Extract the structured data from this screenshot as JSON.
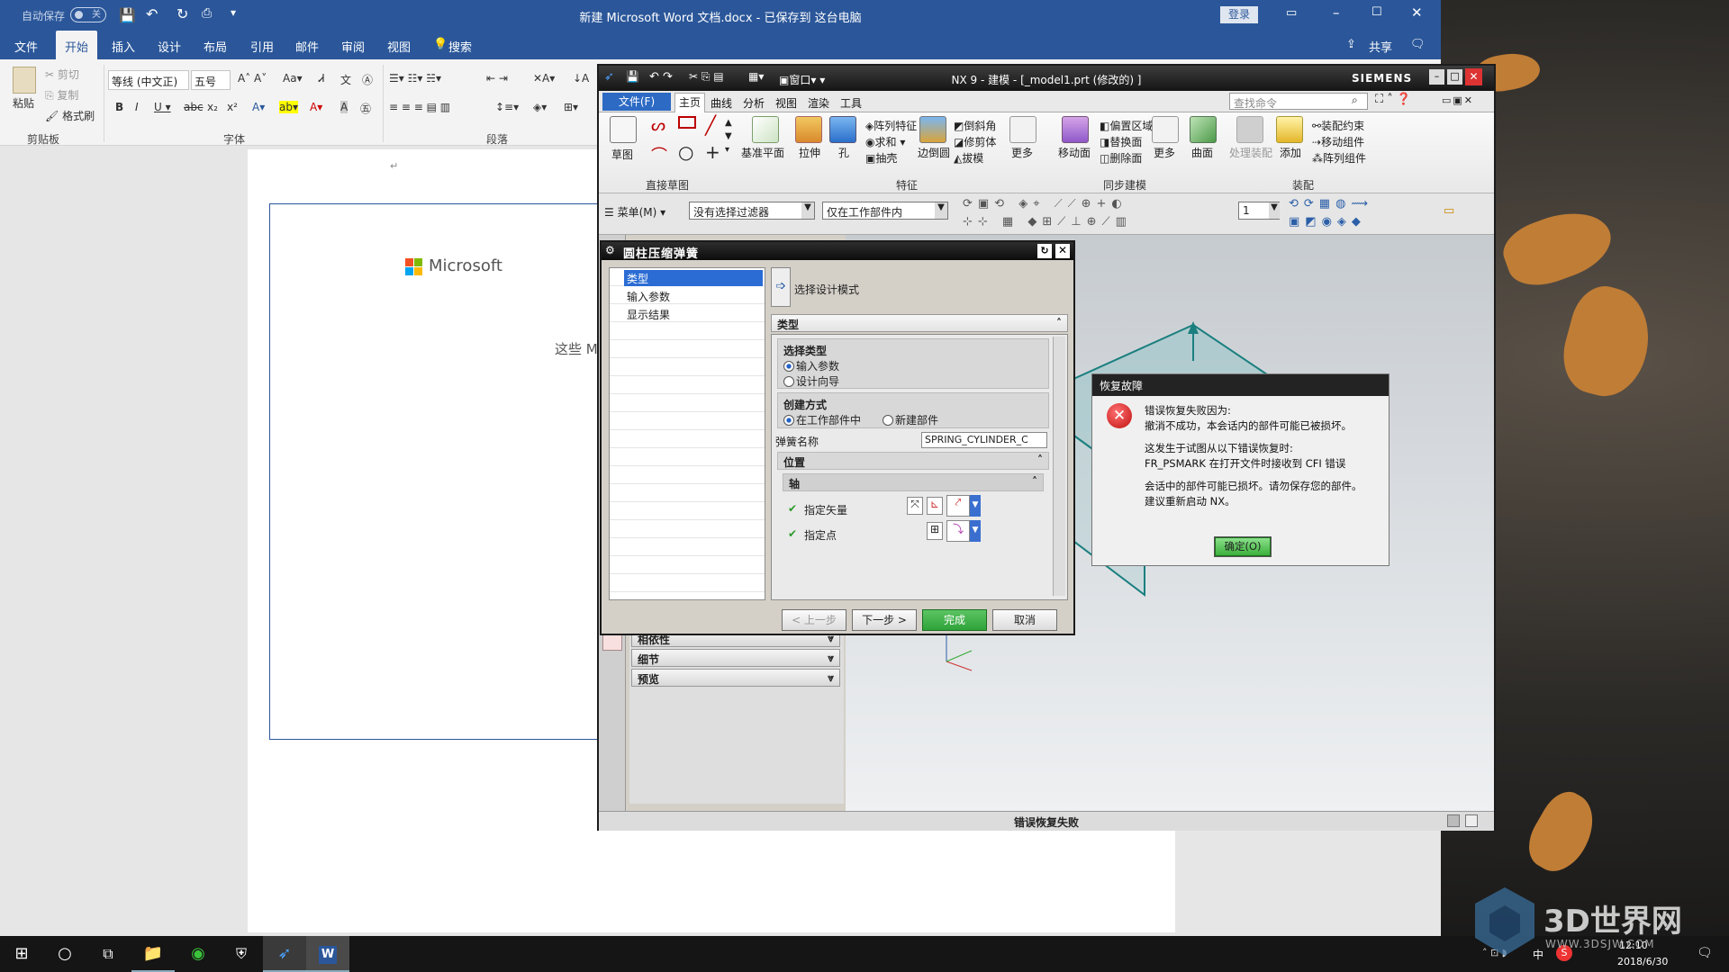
{
  "word": {
    "autosave_label": "自动保存",
    "autosave_state": "关",
    "title": "新建 Microsoft Word 文档.docx - 已保存到 这台电脑",
    "login_button": "登录",
    "share_label": "共享",
    "tabs": [
      "文件",
      "开始",
      "插入",
      "设计",
      "布局",
      "引用",
      "邮件",
      "审阅",
      "视图"
    ],
    "search_label": "搜索",
    "clipboard": {
      "paste": "粘贴",
      "cut": "剪切",
      "copy": "复制",
      "format_painter": "格式刷",
      "group": "剪贴板"
    },
    "font": {
      "name": "等线 (中文正)",
      "size": "五号",
      "group": "字体"
    },
    "paragraph_group": "段落",
    "doc_brand": "Microsoft",
    "doc_text": "这些 M",
    "para_mark": "↵"
  },
  "nx": {
    "title": "NX 9 - 建模 - [_model1.prt  (修改的)  ]",
    "brand": "SIEMENS",
    "window_menu": "窗口",
    "search_placeholder": "查找命令",
    "tabs": [
      "文件(F)",
      "主页",
      "曲线",
      "分析",
      "视图",
      "渲染",
      "工具"
    ],
    "ribbon": {
      "sketch": "草图",
      "direct_sketch": "直接草图",
      "datum_plane": "基准平面",
      "extrude": "拉伸",
      "hole": "孔",
      "pattern_feature": "阵列特征",
      "unite": "求和",
      "shell": "抽壳",
      "edge_blend": "边倒圆",
      "chamfer": "倒斜角",
      "trim_body": "修剪体",
      "draft": "拔模",
      "more": "更多",
      "feature_group": "特征",
      "move_face": "移动面",
      "offset_region": "偏置区域",
      "replace_face": "替换面",
      "delete_face": "删除面",
      "more2": "更多",
      "sync_group": "同步建模",
      "surface": "曲面",
      "process_assembly": "处理装配",
      "add": "添加",
      "assembly_constraint": "装配约束",
      "move_component": "移动组件",
      "pattern_component": "阵列组件",
      "assembly_group": "装配"
    },
    "toolbar": {
      "menu": "菜单(M)",
      "filter": "没有选择过滤器",
      "scope": "仅在工作部件内",
      "layer": "1"
    },
    "navigator_sections": [
      "相依性",
      "细节",
      "预览"
    ],
    "status": "错误恢复失败"
  },
  "spring_dialog": {
    "title": "圆柱压缩弹簧",
    "tree": [
      "类型",
      "输入参数",
      "显示结果"
    ],
    "mode": "选择设计模式",
    "section_type": "类型",
    "select_type_label": "选择类型",
    "type_options": [
      "输入参数",
      "设计向导"
    ],
    "create_method_label": "创建方式",
    "create_options": [
      "在工作部件中",
      "新建部件"
    ],
    "spring_name_label": "弹簧名称",
    "spring_name_value": "SPRING_CYLINDER_C",
    "position_label": "位置",
    "axis_label": "轴",
    "specify_vector": "指定矢量",
    "specify_point": "指定点",
    "buttons": {
      "back": "< 上一步",
      "next": "下一步 >",
      "finish": "完成",
      "cancel": "取消"
    }
  },
  "error_dialog": {
    "title": "恢复故障",
    "line1": "错误恢复失败因为:",
    "line2": "撤消不成功，本会话内的部件可能已被损坏。",
    "line3": "这发生于试图从以下错误恢复时:",
    "line4": "FR_PSMARK 在打开文件时接收到 CFI 错误",
    "line5": "会话中的部件可能已损坏。请勿保存您的部件。",
    "line6": "建议重新启动 NX。",
    "ok_button": "确定(O)"
  },
  "taskbar": {
    "time": "12:10",
    "date": "2018/6/30",
    "ime": "中"
  },
  "watermark": {
    "brand": "3D世界网",
    "url": "WWW.3DSJW.COM"
  },
  "colors": {
    "word_blue": "#2b579a",
    "nx_dark": "#1c1c1c",
    "error_red": "#d42020",
    "finish_green": "#2fa33a"
  }
}
